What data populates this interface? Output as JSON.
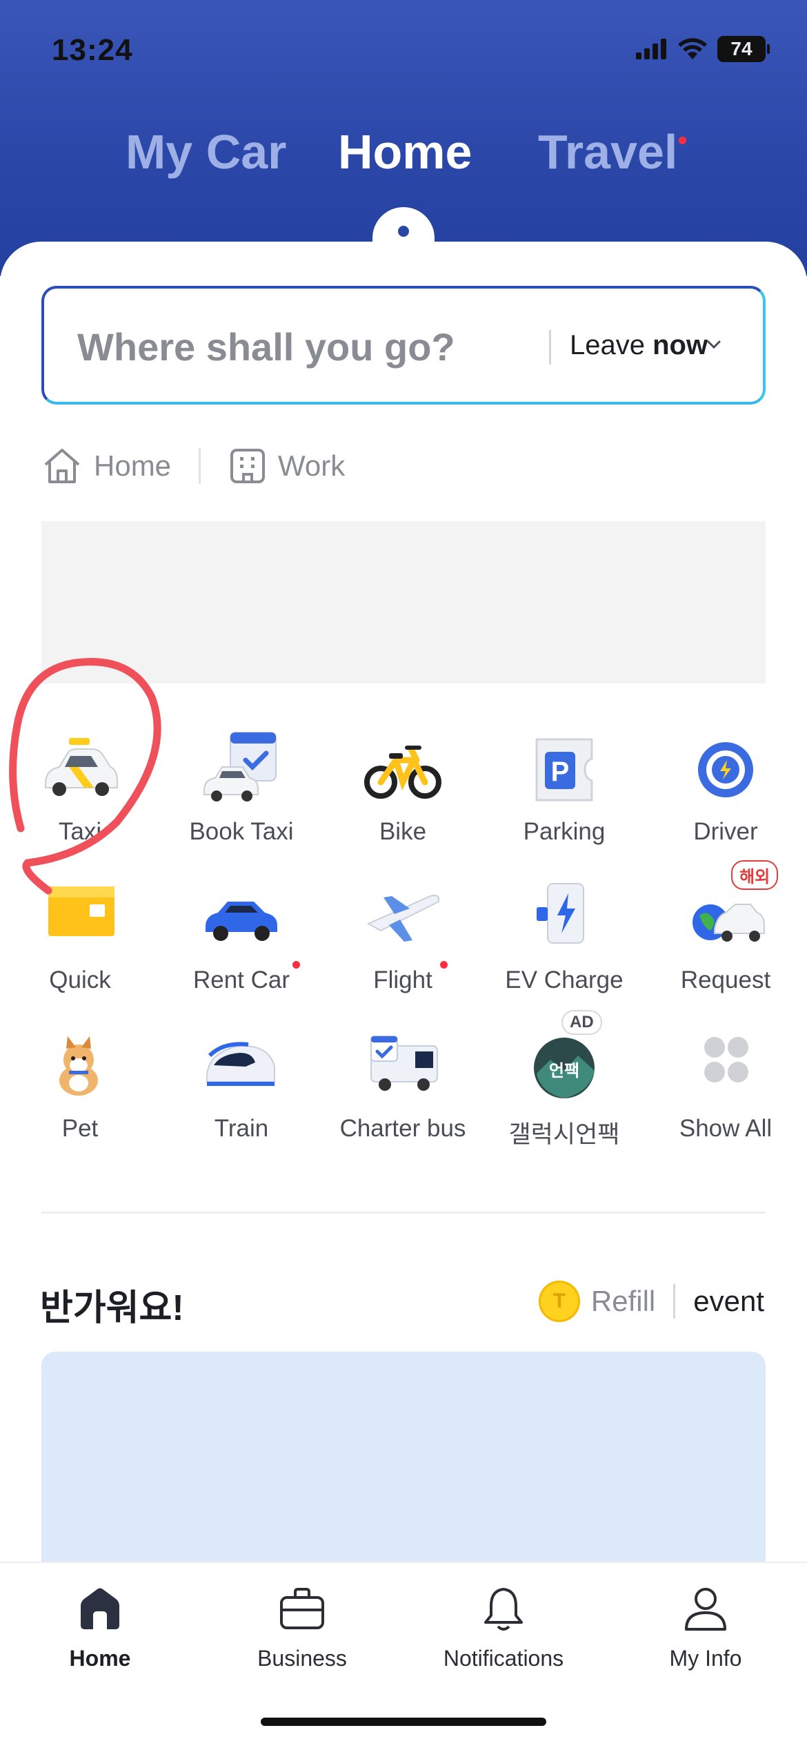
{
  "status_bar": {
    "time": "13:24",
    "battery": "74"
  },
  "top_tabs": [
    {
      "label": "My Car",
      "active": false
    },
    {
      "label": "Home",
      "active": true
    },
    {
      "label": "Travel",
      "active": false,
      "has_dot": true
    }
  ],
  "search": {
    "placeholder": "Where shall you go?",
    "leave_label_prefix": "Leave",
    "leave_label_value": "now"
  },
  "shortcuts": [
    {
      "label": "Home",
      "icon": "house-icon"
    },
    {
      "label": "Work",
      "icon": "building-icon"
    }
  ],
  "services": [
    {
      "label": "Taxi",
      "icon": "taxi-icon"
    },
    {
      "label": "Book Taxi",
      "icon": "book-taxi-icon"
    },
    {
      "label": "Bike",
      "icon": "bike-icon"
    },
    {
      "label": "Parking",
      "icon": "parking-icon"
    },
    {
      "label": "Driver",
      "icon": "driver-icon"
    },
    {
      "label": "Quick",
      "icon": "quick-box-icon"
    },
    {
      "label": "Rent Car",
      "icon": "rent-car-icon",
      "has_dot": true
    },
    {
      "label": "Flight",
      "icon": "flight-icon",
      "has_dot": true
    },
    {
      "label": "EV Charge",
      "icon": "ev-charge-icon"
    },
    {
      "label": "Request",
      "icon": "request-icon",
      "badge": "해외"
    },
    {
      "label": "Pet",
      "icon": "pet-icon"
    },
    {
      "label": "Train",
      "icon": "train-icon"
    },
    {
      "label": "Charter bus",
      "icon": "charter-bus-icon"
    },
    {
      "label": "갤럭시언팩",
      "icon": "galaxy-unpacked-icon",
      "badge": "AD",
      "icon_text": "언팩"
    },
    {
      "label": "Show All",
      "icon": "show-all-icon"
    }
  ],
  "welcome": {
    "title": "반가워요!",
    "coin_letter": "T",
    "refill_label": "Refill",
    "event_label": "event"
  },
  "bottom_nav": [
    {
      "label": "Home",
      "icon": "home-icon",
      "active": true
    },
    {
      "label": "Business",
      "icon": "briefcase-icon",
      "active": false
    },
    {
      "label": "Notifications",
      "icon": "bell-icon",
      "active": false
    },
    {
      "label": "My Info",
      "icon": "person-icon",
      "active": false
    }
  ],
  "colors": {
    "header_blue": "#2a47a8",
    "accent_red": "#ff2d3f",
    "promo_bg": "#dce9fa",
    "annotation_red": "#f0505a"
  }
}
